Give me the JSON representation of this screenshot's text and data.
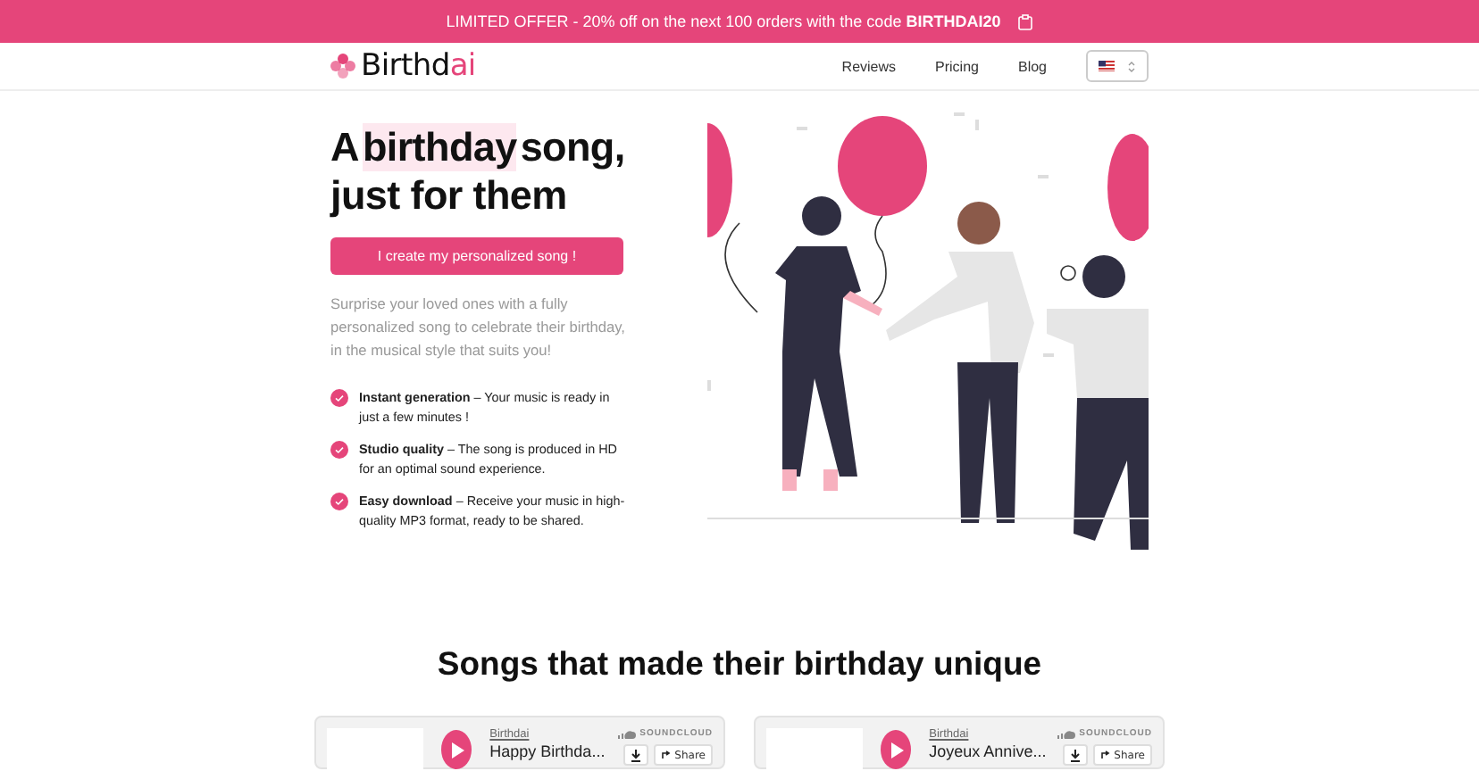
{
  "banner": {
    "text": "LIMITED OFFER - 20% off on the next 100 orders with the code **BIRTHDAI20**"
  },
  "nav": {
    "logo": {
      "main": "Birthd",
      "accent": "ai"
    },
    "links": [
      "Reviews",
      "Pricing",
      "Blog"
    ],
    "language": {
      "kind": "flag-us"
    }
  },
  "hero": {
    "title": [
      [
        {
          "text": "A",
          "highlight": false
        },
        {
          "text": "birthday",
          "highlight": true
        },
        {
          "text": "song,",
          "highlight": false
        }
      ],
      [
        {
          "text": "just for them",
          "highlight": false
        }
      ]
    ],
    "cta": "I create my personalized song !",
    "description": "Surprise your loved ones with a fully personalized song to celebrate their birthday, in the musical style that suits you!",
    "features": [
      {
        "text": "**Instant generation** – Your music is ready in just a few minutes !"
      },
      {
        "text": "**Studio quality** – The song is produced in HD for an optimal sound experience."
      },
      {
        "text": "**Easy download** – Receive your music in high-quality MP3 format, ready to be shared."
      }
    ]
  },
  "songs": {
    "heading": "Songs that made their birthday unique",
    "players": [
      {
        "artist": "Birthdai",
        "title": "Happy Birthda...",
        "brand": "SOUNDCLOUD",
        "share": "Share"
      },
      {
        "artist": "Birthdai",
        "title": "Joyeux Annive...",
        "brand": "SOUNDCLOUD",
        "share": "Share"
      }
    ]
  }
}
